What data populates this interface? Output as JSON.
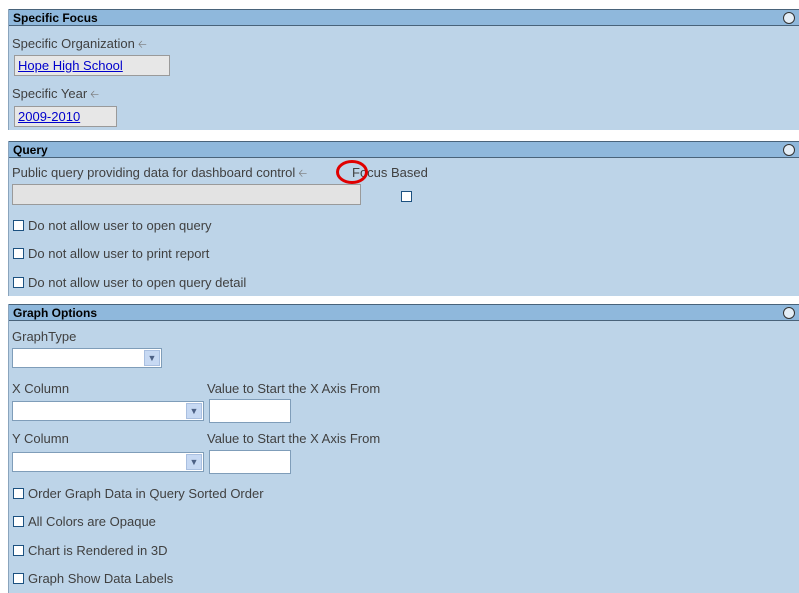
{
  "specific_focus": {
    "title": "Specific Focus",
    "org_label": "Specific Organization",
    "org_value": "Hope High School",
    "year_label": "Specific Year",
    "year_value": "2009-2010"
  },
  "query": {
    "title": "Query",
    "public_query_label": "Public query providing data for dashboard control",
    "focus_based_label": "Focus Based",
    "public_query_value": "",
    "focus_based_checked": false,
    "checkboxes": [
      {
        "label": "Do not allow user to open query",
        "checked": false
      },
      {
        "label": "Do not allow user to print report",
        "checked": false
      },
      {
        "label": "Do not allow user to open query detail",
        "checked": false
      }
    ]
  },
  "graph_options": {
    "title": "Graph Options",
    "graph_type_label": "GraphType",
    "graph_type_value": "",
    "x_column_label": "X Column",
    "x_start_label": "Value to Start the X Axis From",
    "x_start_value": "",
    "y_column_label": "Y Column",
    "y_start_label": "Value to Start the X Axis From",
    "y_start_value": "",
    "checkboxes": [
      {
        "label": "Order Graph Data in Query Sorted Order",
        "checked": false
      },
      {
        "label": "All Colors are Opaque",
        "checked": false
      },
      {
        "label": "Chart is Rendered in 3D",
        "checked": false
      },
      {
        "label": "Graph Show Data Labels",
        "checked": false
      }
    ]
  },
  "icons": {
    "arrow": "left-arrow-icon",
    "collapse": "collapse-icon",
    "dropdown": "chevron-down-icon"
  },
  "colors": {
    "panel_bg": "#bdd4e8",
    "header_bg": "#8fb8dc",
    "highlight": "#e00000",
    "link": "#0000cc"
  }
}
